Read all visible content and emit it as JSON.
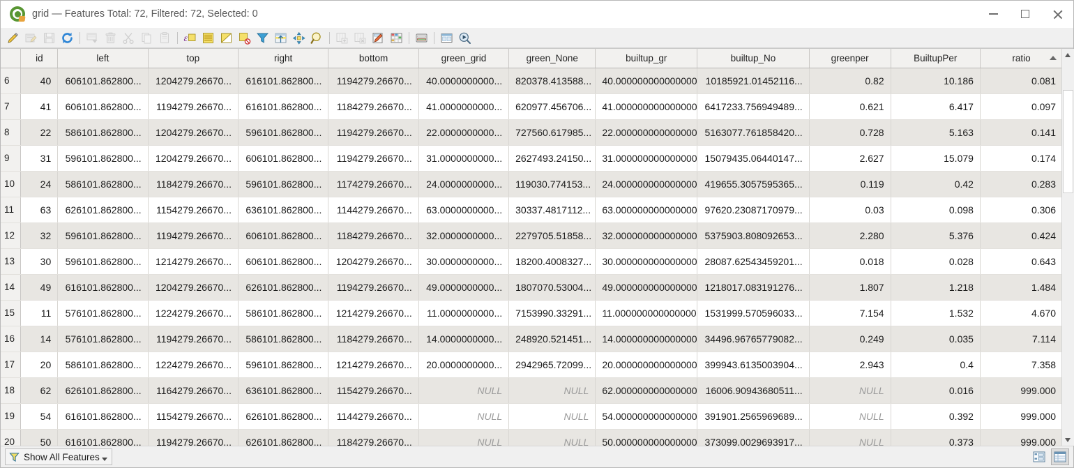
{
  "window": {
    "title": "grid — Features Total: 72, Filtered: 72, Selected: 0",
    "minimize_label": "Minimize",
    "maximize_label": "Maximize",
    "close_label": "Close"
  },
  "toolbar": {
    "items": [
      {
        "name": "toggle-editing",
        "label": "Toggle editing mode",
        "enabled": true
      },
      {
        "name": "save-edits",
        "label": "Save edits",
        "enabled": false
      },
      {
        "name": "save-layer-edits",
        "label": "Save layer edits",
        "enabled": false
      },
      {
        "name": "reload-table",
        "label": "Reload the table",
        "enabled": true
      },
      {
        "name": "add-feature",
        "label": "Add feature",
        "enabled": false
      },
      {
        "name": "delete-selected",
        "label": "Delete selected features",
        "enabled": false
      },
      {
        "name": "cut-features",
        "label": "Cut selected features to clipboard",
        "enabled": false
      },
      {
        "name": "copy-features",
        "label": "Copy selected features to clipboard",
        "enabled": false
      },
      {
        "name": "paste-features",
        "label": "Paste features from clipboard",
        "enabled": false
      },
      {
        "name": "select-by-expression",
        "label": "Select features using an expression",
        "enabled": true
      },
      {
        "name": "select-all",
        "label": "Select all features",
        "enabled": true
      },
      {
        "name": "invert-selection",
        "label": "Invert selection",
        "enabled": true
      },
      {
        "name": "deselect-all",
        "label": "Deselect all features",
        "enabled": true
      },
      {
        "name": "filter-select",
        "label": "Filter / select features using form",
        "enabled": true
      },
      {
        "name": "move-selection-to-top",
        "label": "Move selection to top",
        "enabled": true
      },
      {
        "name": "pan-map-to-selected",
        "label": "Pan map to selected rows",
        "enabled": true
      },
      {
        "name": "zoom-map-to-selected",
        "label": "Zoom map to selected rows",
        "enabled": true
      },
      {
        "name": "new-field",
        "label": "New field",
        "enabled": false
      },
      {
        "name": "delete-field",
        "label": "Delete field",
        "enabled": false
      },
      {
        "name": "open-field-calculator",
        "label": "Open field calculator",
        "enabled": true
      },
      {
        "name": "conditional-formatting",
        "label": "Conditional formatting",
        "enabled": true
      },
      {
        "name": "multi-edit-attributes",
        "label": "Toggle multi edit mode",
        "enabled": true
      },
      {
        "name": "organize-columns",
        "label": "Organize columns",
        "enabled": true
      },
      {
        "name": "actions",
        "label": "Actions",
        "enabled": true
      }
    ]
  },
  "table": {
    "columns": [
      {
        "key": "id",
        "label": "id"
      },
      {
        "key": "left",
        "label": "left"
      },
      {
        "key": "top",
        "label": "top"
      },
      {
        "key": "right",
        "label": "right"
      },
      {
        "key": "bottom",
        "label": "bottom"
      },
      {
        "key": "green_grid",
        "label": "green_grid"
      },
      {
        "key": "green_None",
        "label": "green_None"
      },
      {
        "key": "builtup_gr",
        "label": "builtup_gr"
      },
      {
        "key": "builtup_No",
        "label": "builtup_No"
      },
      {
        "key": "greenper",
        "label": "greenper"
      },
      {
        "key": "BuiltupPer",
        "label": "BuiltupPer"
      },
      {
        "key": "ratio",
        "label": "ratio"
      }
    ],
    "sort": {
      "column": "ratio",
      "direction": "ascending"
    },
    "rows": [
      {
        "n": "6",
        "alt": true,
        "id": "40",
        "left": "606101.862800...",
        "top": "1204279.26670...",
        "right": "616101.862800...",
        "bottom": "1194279.26670...",
        "green_grid": "40.0000000000...",
        "green_None": "820378.413588...",
        "builtup_gr": "40.000000000000000",
        "builtup_No": "10185921.01452116...",
        "greenper": "0.82",
        "BuiltupPer": "10.186",
        "ratio": "0.081"
      },
      {
        "n": "7",
        "alt": false,
        "id": "41",
        "left": "606101.862800...",
        "top": "1194279.26670...",
        "right": "616101.862800...",
        "bottom": "1184279.26670...",
        "green_grid": "41.0000000000...",
        "green_None": "620977.456706...",
        "builtup_gr": "41.000000000000000",
        "builtup_No": "6417233.756949489...",
        "greenper": "0.621",
        "BuiltupPer": "6.417",
        "ratio": "0.097"
      },
      {
        "n": "8",
        "alt": true,
        "id": "22",
        "left": "586101.862800...",
        "top": "1204279.26670...",
        "right": "596101.862800...",
        "bottom": "1194279.26670...",
        "green_grid": "22.0000000000...",
        "green_None": "727560.617985...",
        "builtup_gr": "22.000000000000000",
        "builtup_No": "5163077.761858420...",
        "greenper": "0.728",
        "BuiltupPer": "5.163",
        "ratio": "0.141"
      },
      {
        "n": "9",
        "alt": false,
        "id": "31",
        "left": "596101.862800...",
        "top": "1204279.26670...",
        "right": "606101.862800...",
        "bottom": "1194279.26670...",
        "green_grid": "31.0000000000...",
        "green_None": "2627493.24150...",
        "builtup_gr": "31.000000000000000",
        "builtup_No": "15079435.06440147...",
        "greenper": "2.627",
        "BuiltupPer": "15.079",
        "ratio": "0.174"
      },
      {
        "n": "10",
        "alt": true,
        "id": "24",
        "left": "586101.862800...",
        "top": "1184279.26670...",
        "right": "596101.862800...",
        "bottom": "1174279.26670...",
        "green_grid": "24.0000000000...",
        "green_None": "119030.774153...",
        "builtup_gr": "24.000000000000000",
        "builtup_No": "419655.3057595365...",
        "greenper": "0.119",
        "BuiltupPer": "0.42",
        "ratio": "0.283"
      },
      {
        "n": "11",
        "alt": false,
        "id": "63",
        "left": "626101.862800...",
        "top": "1154279.26670...",
        "right": "636101.862800...",
        "bottom": "1144279.26670...",
        "green_grid": "63.0000000000...",
        "green_None": "30337.4817112...",
        "builtup_gr": "63.000000000000000",
        "builtup_No": "97620.23087170979...",
        "greenper": "0.03",
        "BuiltupPer": "0.098",
        "ratio": "0.306"
      },
      {
        "n": "12",
        "alt": true,
        "id": "32",
        "left": "596101.862800...",
        "top": "1194279.26670...",
        "right": "606101.862800...",
        "bottom": "1184279.26670...",
        "green_grid": "32.0000000000...",
        "green_None": "2279705.51858...",
        "builtup_gr": "32.000000000000000",
        "builtup_No": "5375903.808092653...",
        "greenper": "2.280",
        "BuiltupPer": "5.376",
        "ratio": "0.424"
      },
      {
        "n": "13",
        "alt": false,
        "id": "30",
        "left": "596101.862800...",
        "top": "1214279.26670...",
        "right": "606101.862800...",
        "bottom": "1204279.26670...",
        "green_grid": "30.0000000000...",
        "green_None": "18200.4008327...",
        "builtup_gr": "30.000000000000000",
        "builtup_No": "28087.62543459201...",
        "greenper": "0.018",
        "BuiltupPer": "0.028",
        "ratio": "0.643"
      },
      {
        "n": "14",
        "alt": true,
        "id": "49",
        "left": "616101.862800...",
        "top": "1204279.26670...",
        "right": "626101.862800...",
        "bottom": "1194279.26670...",
        "green_grid": "49.0000000000...",
        "green_None": "1807070.53004...",
        "builtup_gr": "49.000000000000000",
        "builtup_No": "1218017.083191276...",
        "greenper": "1.807",
        "BuiltupPer": "1.218",
        "ratio": "1.484"
      },
      {
        "n": "15",
        "alt": false,
        "id": "11",
        "left": "576101.862800...",
        "top": "1224279.26670...",
        "right": "586101.862800...",
        "bottom": "1214279.26670...",
        "green_grid": "11.0000000000...",
        "green_None": "7153990.33291...",
        "builtup_gr": "11.000000000000000",
        "builtup_No": "1531999.570596033...",
        "greenper": "7.154",
        "BuiltupPer": "1.532",
        "ratio": "4.670"
      },
      {
        "n": "16",
        "alt": true,
        "id": "14",
        "left": "576101.862800...",
        "top": "1194279.26670...",
        "right": "586101.862800...",
        "bottom": "1184279.26670...",
        "green_grid": "14.0000000000...",
        "green_None": "248920.521451...",
        "builtup_gr": "14.000000000000000",
        "builtup_No": "34496.96765779082...",
        "greenper": "0.249",
        "BuiltupPer": "0.035",
        "ratio": "7.114"
      },
      {
        "n": "17",
        "alt": false,
        "id": "20",
        "left": "586101.862800...",
        "top": "1224279.26670...",
        "right": "596101.862800...",
        "bottom": "1214279.26670...",
        "green_grid": "20.0000000000...",
        "green_None": "2942965.72099...",
        "builtup_gr": "20.000000000000000",
        "builtup_No": "399943.6135003904...",
        "greenper": "2.943",
        "BuiltupPer": "0.4",
        "ratio": "7.358"
      },
      {
        "n": "18",
        "alt": true,
        "id": "62",
        "left": "626101.862800...",
        "top": "1164279.26670...",
        "right": "636101.862800...",
        "bottom": "1154279.26670...",
        "green_grid": "NULL",
        "green_None": "NULL",
        "builtup_gr": "62.000000000000000",
        "builtup_No": "16006.90943680511...",
        "greenper": "NULL",
        "BuiltupPer": "0.016",
        "ratio": "999.000"
      },
      {
        "n": "19",
        "alt": false,
        "id": "54",
        "left": "616101.862800...",
        "top": "1154279.26670...",
        "right": "626101.862800...",
        "bottom": "1144279.26670...",
        "green_grid": "NULL",
        "green_None": "NULL",
        "builtup_gr": "54.000000000000000",
        "builtup_No": "391901.2565969689...",
        "greenper": "NULL",
        "BuiltupPer": "0.392",
        "ratio": "999.000"
      },
      {
        "n": "20",
        "alt": true,
        "id": "50",
        "left": "616101.862800...",
        "top": "1194279.26670...",
        "right": "626101.862800...",
        "bottom": "1184279.26670...",
        "green_grid": "NULL",
        "green_None": "NULL",
        "builtup_gr": "50.000000000000000",
        "builtup_No": "373099.0029693917...",
        "greenper": "NULL",
        "BuiltupPer": "0.373",
        "ratio": "999.000"
      }
    ]
  },
  "statusbar": {
    "filter_label": "Show All Features",
    "form_view_label": "Switch to form view",
    "table_view_label": "Switch to table view"
  },
  "colors": {
    "accent_green": "#589632",
    "accent_orange": "#e8a33d",
    "row_alt": "#e8e6e2",
    "header_bg": "#f2f1ef",
    "null_text": "#9a9a9a"
  }
}
